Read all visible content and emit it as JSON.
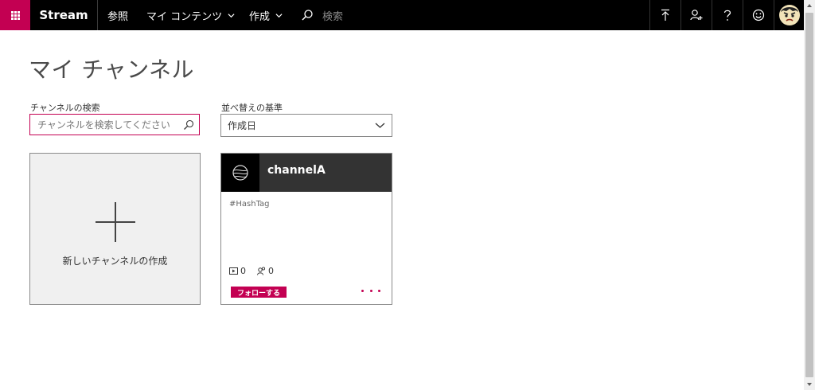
{
  "header": {
    "brand": "Stream",
    "nav": [
      "参照",
      "マイ コンテンツ",
      "作成"
    ],
    "search_placeholder": "検索",
    "icons": [
      "upload-icon",
      "invite-user-icon",
      "help-icon",
      "feedback-smiley-icon"
    ],
    "accent_color": "#c30052"
  },
  "page": {
    "title": "マイ チャンネル"
  },
  "filters": {
    "search_label": "チャンネルの検索",
    "search_placeholder": "チャンネルを検索してください",
    "sort_label": "並べ替えの基準",
    "sort_value": "作成日"
  },
  "new_channel": {
    "label": "新しいチャンネルの作成"
  },
  "channels": [
    {
      "name": "channelA",
      "hashtag": "#HashTag",
      "video_count": "0",
      "follower_count": "0",
      "follow_label": "フォローする"
    }
  ]
}
